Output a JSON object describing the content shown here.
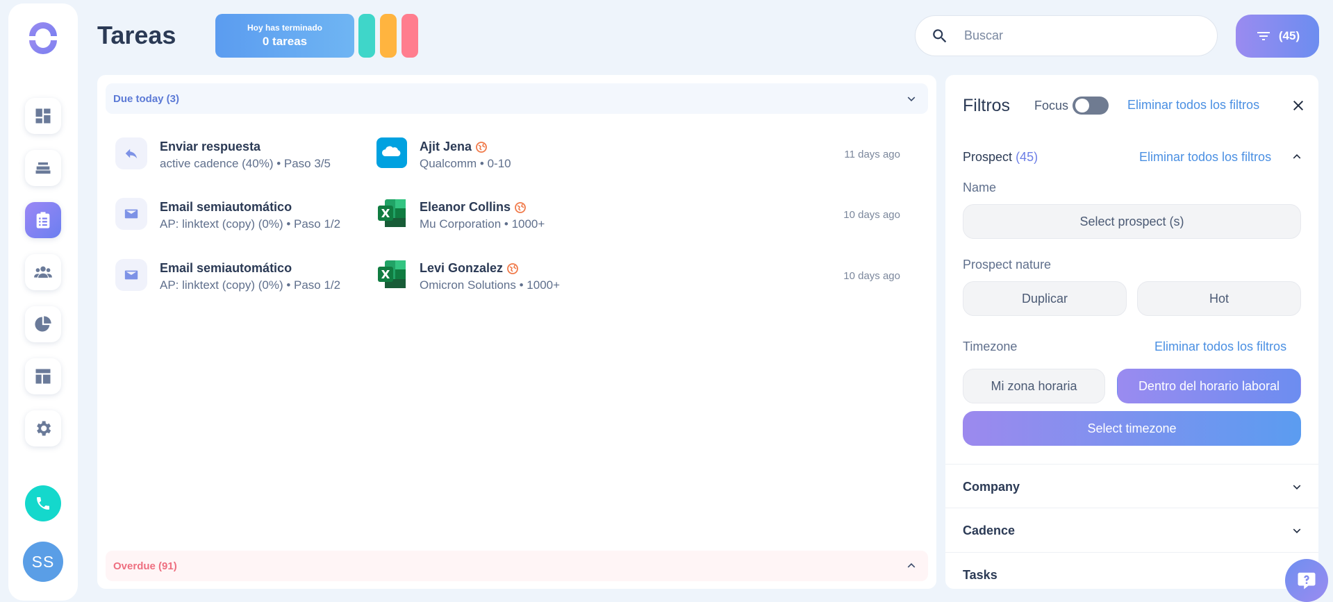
{
  "page": {
    "title": "Tareas"
  },
  "progress": {
    "line1": "Hoy has terminado",
    "line2": "0 tareas"
  },
  "colors": {
    "pill1": "#3fd6c9",
    "pill2": "#ffb43f",
    "pill3": "#ff7d8e",
    "accent": "#6c8df0",
    "overdue": "#ee6f80"
  },
  "search": {
    "placeholder": "Buscar"
  },
  "filter_button": {
    "label": "(45)"
  },
  "sidebar": {
    "items": [
      {
        "icon": "dashboard-icon"
      },
      {
        "icon": "inbox-stack-icon"
      },
      {
        "icon": "clipboard-tasks-icon",
        "active": true
      },
      {
        "icon": "people-icon"
      },
      {
        "icon": "pie-chart-icon"
      },
      {
        "icon": "layout-icon"
      },
      {
        "icon": "gear-icon"
      }
    ],
    "avatar_initials": "SS"
  },
  "groups": {
    "due_today": "Due today (3)",
    "overdue": "Overdue (91)"
  },
  "tasks": [
    {
      "type": "reply",
      "title": "Enviar respuesta",
      "subtitle": "active cadence (40%) • Paso 3/5",
      "source": "salesforce",
      "name": "Ajit Jena",
      "company": "Qualcomm • 0-10",
      "time": "11 days ago"
    },
    {
      "type": "email",
      "title": "Email semiautomático",
      "subtitle": "AP: linktext (copy) (0%) • Paso 1/2",
      "source": "excel",
      "name": "Eleanor Collins",
      "company": "Mu Corporation • 1000+",
      "time": "10 days ago"
    },
    {
      "type": "email",
      "title": "Email semiautomático",
      "subtitle": "AP: linktext (copy) (0%) • Paso 1/2",
      "source": "excel",
      "name": "Levi Gonzalez",
      "company": "Omicron Solutions • 1000+",
      "time": "10 days ago"
    }
  ],
  "filters": {
    "title": "Filtros",
    "focus_label": "Focus",
    "clear_all": "Eliminar todos los filtros",
    "prospect": {
      "title": "Prospect",
      "count": "(45)",
      "clear": "Eliminar todos los filtros"
    },
    "name_label": "Name",
    "select_prospect": "Select prospect (s)",
    "nature_label": "Prospect nature",
    "nature_options": [
      "Duplicar",
      "Hot"
    ],
    "timezone_label": "Timezone",
    "timezone_clear": "Eliminar todos los filtros",
    "timezone_options": [
      "Mi zona horaria",
      "Dentro del horario laboral"
    ],
    "select_timezone": "Select timezone",
    "sections": [
      "Company",
      "Cadence",
      "Tasks"
    ]
  }
}
